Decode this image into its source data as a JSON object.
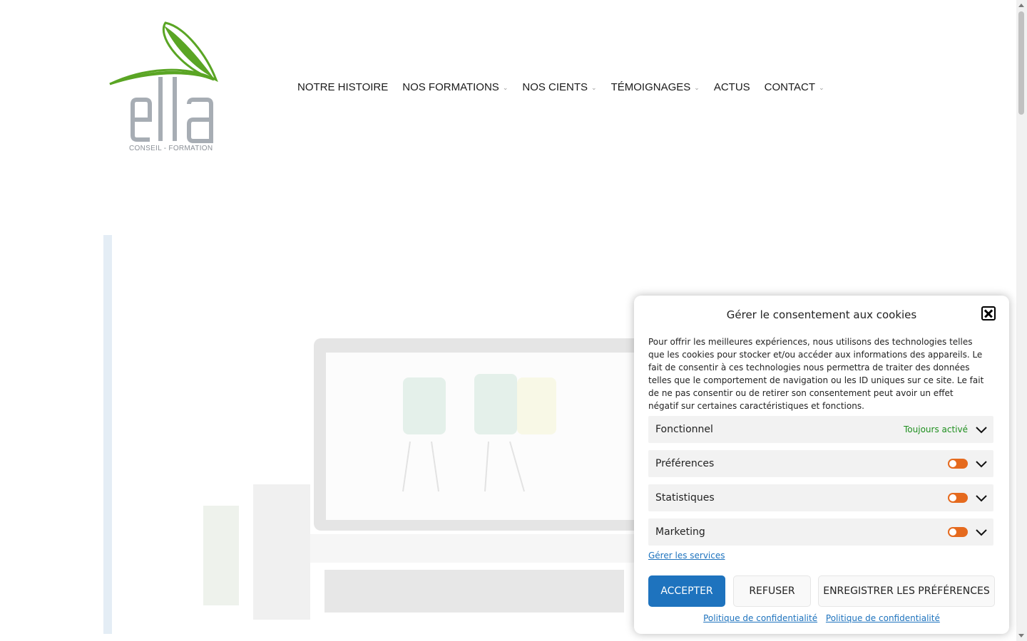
{
  "logo": {
    "subtitle": "CONSEIL - FORMATION"
  },
  "nav": {
    "items": [
      {
        "label": "NOTRE HISTOIRE"
      },
      {
        "label": "NOS FORMATIONS"
      },
      {
        "label": "NOS CIENTS"
      },
      {
        "label": "TÉMOIGNAGES"
      },
      {
        "label": "ACTUS"
      },
      {
        "label": "CONTACT"
      }
    ]
  },
  "cookie": {
    "title": "Gérer le consentement aux cookies",
    "description": "Pour offrir les meilleures expériences, nous utilisons des technologies telles que les cookies pour stocker et/ou accéder aux informations des appareils. Le fait de consentir à ces technologies nous permettra de traiter des données telles que le comportement de navigation ou les ID uniques sur ce site. Le fait de ne pas consentir ou de retirer son consentement peut avoir un effet négatif sur certaines caractéristiques et fonctions.",
    "categories": [
      {
        "label": "Fonctionnel",
        "status": "Toujours activé"
      },
      {
        "label": "Préférences",
        "enabled": false
      },
      {
        "label": "Statistiques",
        "enabled": false
      },
      {
        "label": "Marketing",
        "enabled": false
      }
    ],
    "manage_link": "Gérer les services",
    "accept_label": "ACCEPTER",
    "refuse_label": "REFUSER",
    "save_label": "ENREGISTRER LES PRÉFÉRENCES",
    "policy_links": [
      "Politique de confidentialité",
      "Politique de confidentialité"
    ]
  },
  "colors": {
    "accent": "#1e73be",
    "toggle": "#e56a1e",
    "status_green": "#1e8f1e",
    "logo_green": "#5aa524",
    "logo_grey": "#9aa1a8"
  }
}
